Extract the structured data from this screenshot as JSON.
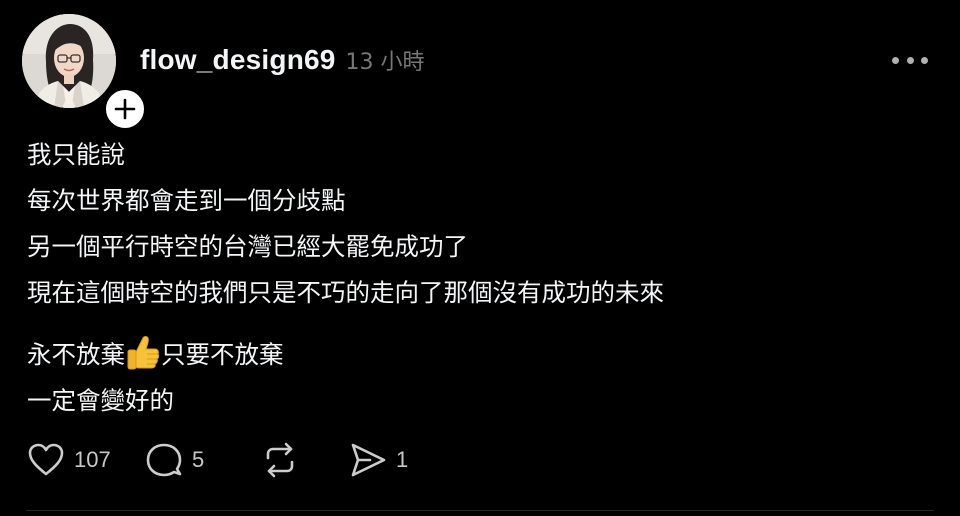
{
  "post": {
    "username": "flow_design69",
    "timestamp": "13 小時",
    "lines": [
      "我只能說",
      "每次世界都會走到一個分歧點",
      "另一個平行時空的台灣已經大罷免成功了",
      "現在這個時空的我們只是不巧的走向了那個沒有成功的未來"
    ],
    "line5_before": "永不放棄",
    "line5_after": "只要不放棄",
    "line6": "一定會變好的"
  },
  "icons": {
    "avatar": "profile-photo",
    "follow": "plus-icon",
    "more": "more-horizontal-icon",
    "emoji": "thumbs-up-emoji",
    "like": "heart-icon",
    "reply": "comment-icon",
    "repost": "repost-icon",
    "share": "send-icon"
  },
  "actions": {
    "likes": "107",
    "replies": "5",
    "shares": "1"
  },
  "colors": {
    "background": "#000000",
    "text": "#f3f5f7",
    "muted": "#777777",
    "icon": "#cccccc"
  }
}
